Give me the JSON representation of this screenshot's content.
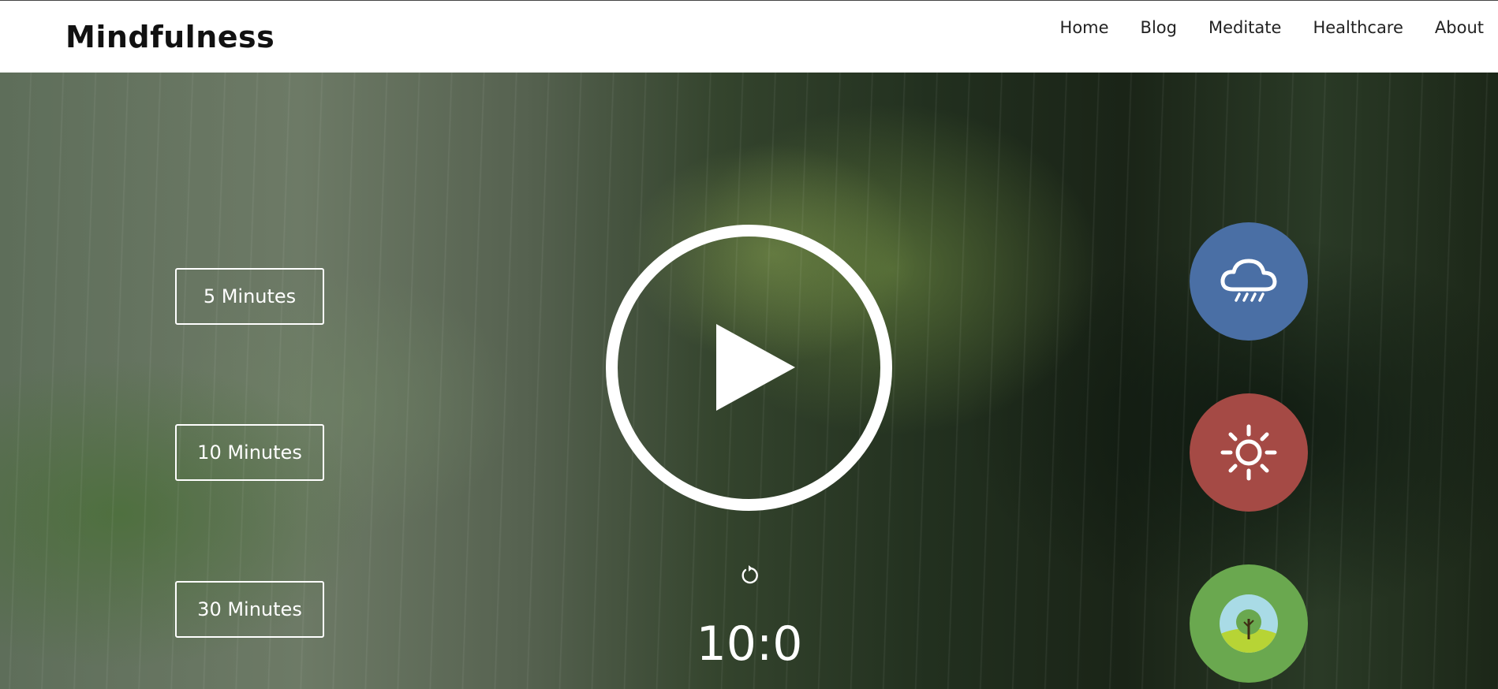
{
  "header": {
    "logo": "Mindfulness",
    "nav": [
      "Home",
      "Blog",
      "Meditate",
      "Healthcare",
      "About"
    ]
  },
  "durations": [
    "5 Minutes",
    "10 Minutes",
    "30 Minutes"
  ],
  "player": {
    "play_icon": "play-icon",
    "replay_icon": "replay-icon",
    "timer": "10:0"
  },
  "sounds": [
    {
      "icon": "rain-cloud-icon",
      "color": "#4a6fa5"
    },
    {
      "icon": "sun-icon",
      "color": "#a54a45"
    },
    {
      "icon": "tree-icon",
      "color": "#6aa84f"
    }
  ]
}
